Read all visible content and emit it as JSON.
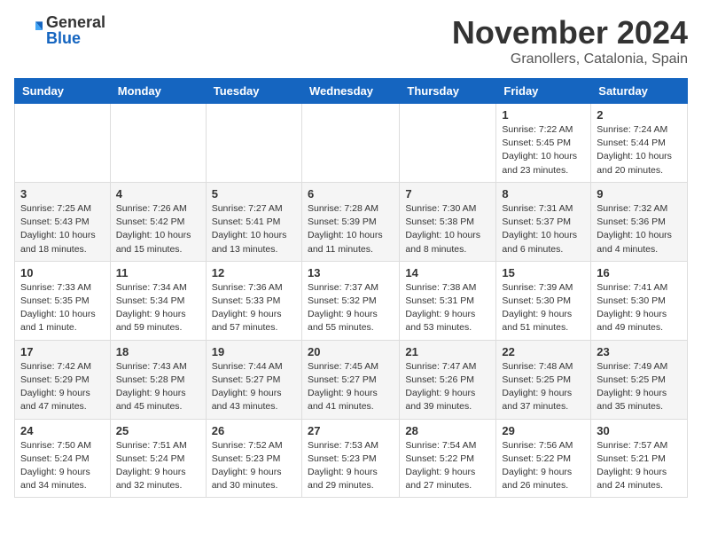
{
  "logo": {
    "general": "General",
    "blue": "Blue"
  },
  "header": {
    "title": "November 2024",
    "subtitle": "Granollers, Catalonia, Spain"
  },
  "days_of_week": [
    "Sunday",
    "Monday",
    "Tuesday",
    "Wednesday",
    "Thursday",
    "Friday",
    "Saturday"
  ],
  "weeks": [
    [
      {
        "day": null
      },
      {
        "day": null
      },
      {
        "day": null
      },
      {
        "day": null
      },
      {
        "day": null
      },
      {
        "day": "1",
        "sunrise": "Sunrise: 7:22 AM",
        "sunset": "Sunset: 5:45 PM",
        "daylight": "Daylight: 10 hours and 23 minutes."
      },
      {
        "day": "2",
        "sunrise": "Sunrise: 7:24 AM",
        "sunset": "Sunset: 5:44 PM",
        "daylight": "Daylight: 10 hours and 20 minutes."
      }
    ],
    [
      {
        "day": "3",
        "sunrise": "Sunrise: 7:25 AM",
        "sunset": "Sunset: 5:43 PM",
        "daylight": "Daylight: 10 hours and 18 minutes."
      },
      {
        "day": "4",
        "sunrise": "Sunrise: 7:26 AM",
        "sunset": "Sunset: 5:42 PM",
        "daylight": "Daylight: 10 hours and 15 minutes."
      },
      {
        "day": "5",
        "sunrise": "Sunrise: 7:27 AM",
        "sunset": "Sunset: 5:41 PM",
        "daylight": "Daylight: 10 hours and 13 minutes."
      },
      {
        "day": "6",
        "sunrise": "Sunrise: 7:28 AM",
        "sunset": "Sunset: 5:39 PM",
        "daylight": "Daylight: 10 hours and 11 minutes."
      },
      {
        "day": "7",
        "sunrise": "Sunrise: 7:30 AM",
        "sunset": "Sunset: 5:38 PM",
        "daylight": "Daylight: 10 hours and 8 minutes."
      },
      {
        "day": "8",
        "sunrise": "Sunrise: 7:31 AM",
        "sunset": "Sunset: 5:37 PM",
        "daylight": "Daylight: 10 hours and 6 minutes."
      },
      {
        "day": "9",
        "sunrise": "Sunrise: 7:32 AM",
        "sunset": "Sunset: 5:36 PM",
        "daylight": "Daylight: 10 hours and 4 minutes."
      }
    ],
    [
      {
        "day": "10",
        "sunrise": "Sunrise: 7:33 AM",
        "sunset": "Sunset: 5:35 PM",
        "daylight": "Daylight: 10 hours and 1 minute."
      },
      {
        "day": "11",
        "sunrise": "Sunrise: 7:34 AM",
        "sunset": "Sunset: 5:34 PM",
        "daylight": "Daylight: 9 hours and 59 minutes."
      },
      {
        "day": "12",
        "sunrise": "Sunrise: 7:36 AM",
        "sunset": "Sunset: 5:33 PM",
        "daylight": "Daylight: 9 hours and 57 minutes."
      },
      {
        "day": "13",
        "sunrise": "Sunrise: 7:37 AM",
        "sunset": "Sunset: 5:32 PM",
        "daylight": "Daylight: 9 hours and 55 minutes."
      },
      {
        "day": "14",
        "sunrise": "Sunrise: 7:38 AM",
        "sunset": "Sunset: 5:31 PM",
        "daylight": "Daylight: 9 hours and 53 minutes."
      },
      {
        "day": "15",
        "sunrise": "Sunrise: 7:39 AM",
        "sunset": "Sunset: 5:30 PM",
        "daylight": "Daylight: 9 hours and 51 minutes."
      },
      {
        "day": "16",
        "sunrise": "Sunrise: 7:41 AM",
        "sunset": "Sunset: 5:30 PM",
        "daylight": "Daylight: 9 hours and 49 minutes."
      }
    ],
    [
      {
        "day": "17",
        "sunrise": "Sunrise: 7:42 AM",
        "sunset": "Sunset: 5:29 PM",
        "daylight": "Daylight: 9 hours and 47 minutes."
      },
      {
        "day": "18",
        "sunrise": "Sunrise: 7:43 AM",
        "sunset": "Sunset: 5:28 PM",
        "daylight": "Daylight: 9 hours and 45 minutes."
      },
      {
        "day": "19",
        "sunrise": "Sunrise: 7:44 AM",
        "sunset": "Sunset: 5:27 PM",
        "daylight": "Daylight: 9 hours and 43 minutes."
      },
      {
        "day": "20",
        "sunrise": "Sunrise: 7:45 AM",
        "sunset": "Sunset: 5:27 PM",
        "daylight": "Daylight: 9 hours and 41 minutes."
      },
      {
        "day": "21",
        "sunrise": "Sunrise: 7:47 AM",
        "sunset": "Sunset: 5:26 PM",
        "daylight": "Daylight: 9 hours and 39 minutes."
      },
      {
        "day": "22",
        "sunrise": "Sunrise: 7:48 AM",
        "sunset": "Sunset: 5:25 PM",
        "daylight": "Daylight: 9 hours and 37 minutes."
      },
      {
        "day": "23",
        "sunrise": "Sunrise: 7:49 AM",
        "sunset": "Sunset: 5:25 PM",
        "daylight": "Daylight: 9 hours and 35 minutes."
      }
    ],
    [
      {
        "day": "24",
        "sunrise": "Sunrise: 7:50 AM",
        "sunset": "Sunset: 5:24 PM",
        "daylight": "Daylight: 9 hours and 34 minutes."
      },
      {
        "day": "25",
        "sunrise": "Sunrise: 7:51 AM",
        "sunset": "Sunset: 5:24 PM",
        "daylight": "Daylight: 9 hours and 32 minutes."
      },
      {
        "day": "26",
        "sunrise": "Sunrise: 7:52 AM",
        "sunset": "Sunset: 5:23 PM",
        "daylight": "Daylight: 9 hours and 30 minutes."
      },
      {
        "day": "27",
        "sunrise": "Sunrise: 7:53 AM",
        "sunset": "Sunset: 5:23 PM",
        "daylight": "Daylight: 9 hours and 29 minutes."
      },
      {
        "day": "28",
        "sunrise": "Sunrise: 7:54 AM",
        "sunset": "Sunset: 5:22 PM",
        "daylight": "Daylight: 9 hours and 27 minutes."
      },
      {
        "day": "29",
        "sunrise": "Sunrise: 7:56 AM",
        "sunset": "Sunset: 5:22 PM",
        "daylight": "Daylight: 9 hours and 26 minutes."
      },
      {
        "day": "30",
        "sunrise": "Sunrise: 7:57 AM",
        "sunset": "Sunset: 5:21 PM",
        "daylight": "Daylight: 9 hours and 24 minutes."
      }
    ]
  ]
}
